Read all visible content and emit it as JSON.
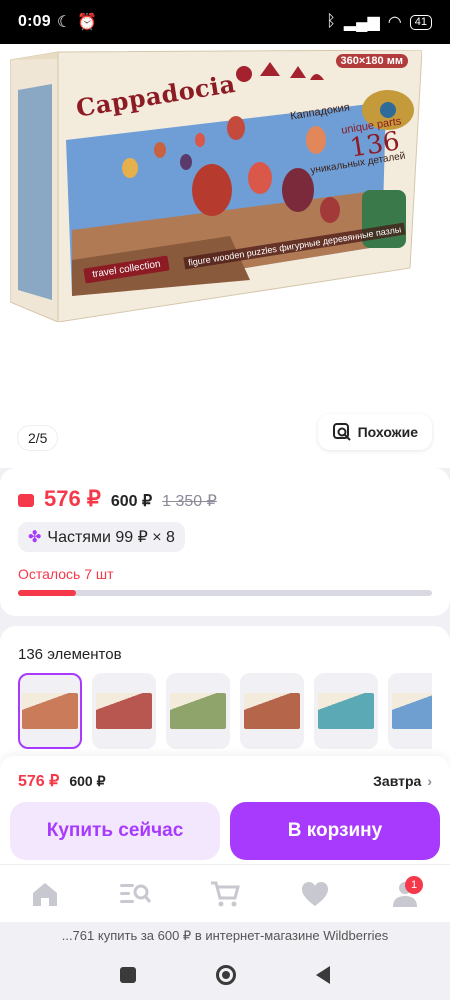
{
  "status_bar": {
    "time": "0:09",
    "battery": "41"
  },
  "product_image": {
    "brand_title": "Cappadocia",
    "title_ru": "Каппадокия",
    "dimensions": "360×180 мм",
    "unique_parts": "unique parts",
    "parts_count": "136",
    "parts_sub": "уникальных деталей",
    "figure_text": "figure wooden puzzles фигурные деревянные пазлы",
    "travel_label": "travel collection"
  },
  "gallery": {
    "counter": "2/5",
    "similar_label": "Похожие"
  },
  "price": {
    "current": "576 ₽",
    "secondary": "600 ₽",
    "old": "1 350 ₽",
    "installment": "Частями 99 ₽ × 8",
    "stock_text": "Осталось 7 шт",
    "stock_fraction": 0.14
  },
  "variants": {
    "title": "136 элементов",
    "items": [
      {
        "name": "cappadocia",
        "color": "#c97b5a"
      },
      {
        "name": "variant-2",
        "color": "#b8574f"
      },
      {
        "name": "variant-3",
        "color": "#8fa46a"
      },
      {
        "name": "variant-4",
        "color": "#b5654a"
      },
      {
        "name": "variant-5",
        "color": "#5aa9b5"
      },
      {
        "name": "variant-6",
        "color": "#6e9fd0"
      }
    ]
  },
  "buy_panel": {
    "price": "576 ₽",
    "price_secondary": "600 ₽",
    "delivery": "Завтра",
    "buy_now": "Купить сейчас",
    "add_to_cart": "В корзину"
  },
  "bottom_nav": {
    "items": [
      "home-icon",
      "catalog-search-icon",
      "cart-icon",
      "favorites-icon",
      "profile-icon"
    ],
    "profile_badge": "1"
  },
  "url_bar": {
    "text": "...761 купить за 600 ₽ в интернет-магазине Wildberries"
  },
  "colors": {
    "accent": "#a73afd",
    "price_red": "#f5384a"
  }
}
